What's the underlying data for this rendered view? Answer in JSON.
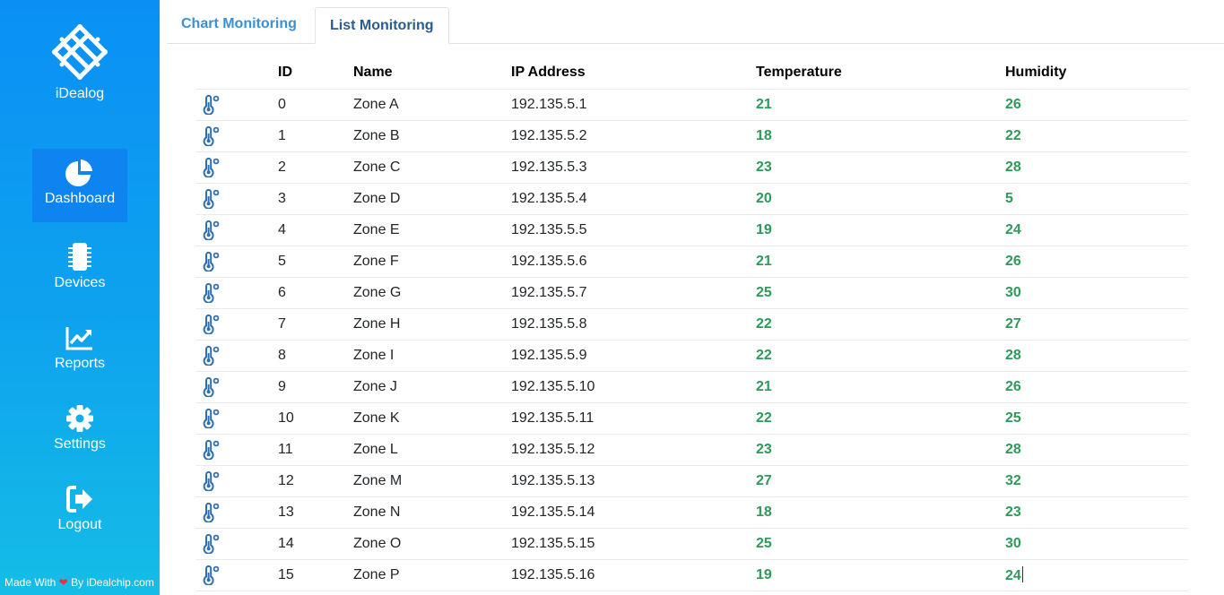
{
  "brand": {
    "name": "iDealog"
  },
  "nav": [
    {
      "key": "dashboard",
      "label": "Dashboard",
      "icon": "pie-chart-icon",
      "active": true
    },
    {
      "key": "devices",
      "label": "Devices",
      "icon": "microchip-icon"
    },
    {
      "key": "reports",
      "label": "Reports",
      "icon": "line-chart-icon"
    },
    {
      "key": "settings",
      "label": "Settings",
      "icon": "gear-icon"
    },
    {
      "key": "logout",
      "label": "Logout",
      "icon": "sign-out-icon"
    }
  ],
  "footer": {
    "prefix": "Made With",
    "heart": "❤",
    "by": "By",
    "link": "iDealchip.com"
  },
  "tabs": [
    {
      "label": "Chart Monitoring",
      "active": false
    },
    {
      "label": "List Monitoring",
      "active": true
    }
  ],
  "table": {
    "columns": [
      "",
      "ID",
      "Name",
      "IP Address",
      "Temperature",
      "Humidity"
    ],
    "row_icon": "thermometer-icon",
    "rows": [
      {
        "id": "0",
        "name": "Zone A",
        "ip": "192.135.5.1",
        "temperature": "21",
        "humidity": "26"
      },
      {
        "id": "1",
        "name": "Zone B",
        "ip": "192.135.5.2",
        "temperature": "18",
        "humidity": "22"
      },
      {
        "id": "2",
        "name": "Zone C",
        "ip": "192.135.5.3",
        "temperature": "23",
        "humidity": "28"
      },
      {
        "id": "3",
        "name": "Zone D",
        "ip": "192.135.5.4",
        "temperature": "20",
        "humidity": "5"
      },
      {
        "id": "4",
        "name": "Zone E",
        "ip": "192.135.5.5",
        "temperature": "19",
        "humidity": "24"
      },
      {
        "id": "5",
        "name": "Zone F",
        "ip": "192.135.5.6",
        "temperature": "21",
        "humidity": "26"
      },
      {
        "id": "6",
        "name": "Zone G",
        "ip": "192.135.5.7",
        "temperature": "25",
        "humidity": "30"
      },
      {
        "id": "7",
        "name": "Zone H",
        "ip": "192.135.5.8",
        "temperature": "22",
        "humidity": "27"
      },
      {
        "id": "8",
        "name": "Zone I",
        "ip": "192.135.5.9",
        "temperature": "22",
        "humidity": "28"
      },
      {
        "id": "9",
        "name": "Zone J",
        "ip": "192.135.5.10",
        "temperature": "21",
        "humidity": "26"
      },
      {
        "id": "10",
        "name": "Zone K",
        "ip": "192.135.5.11",
        "temperature": "22",
        "humidity": "25"
      },
      {
        "id": "11",
        "name": "Zone L",
        "ip": "192.135.5.12",
        "temperature": "23",
        "humidity": "28"
      },
      {
        "id": "12",
        "name": "Zone M",
        "ip": "192.135.5.13",
        "temperature": "27",
        "humidity": "32"
      },
      {
        "id": "13",
        "name": "Zone N",
        "ip": "192.135.5.14",
        "temperature": "18",
        "humidity": "23"
      },
      {
        "id": "14",
        "name": "Zone O",
        "ip": "192.135.5.15",
        "temperature": "25",
        "humidity": "30"
      },
      {
        "id": "15",
        "name": "Zone P",
        "ip": "192.135.5.16",
        "temperature": "19",
        "humidity": "24"
      }
    ]
  },
  "colors": {
    "sidebar_top": "#0a90f5",
    "sidebar_bottom": "#14bde6",
    "active_nav": "#0d84f0",
    "value_green": "#2e9a5a",
    "icon_blue": "#2f6fb0",
    "tab_link": "#3b8fd4"
  }
}
